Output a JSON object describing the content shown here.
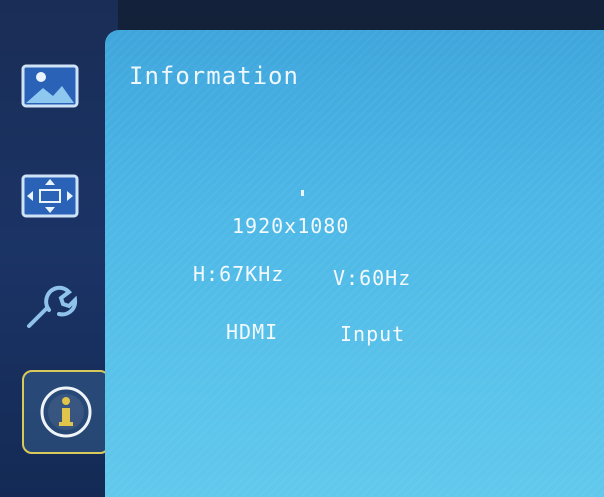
{
  "menu": {
    "items": [
      {
        "icon": "picture-icon",
        "label": ""
      },
      {
        "icon": "position-icon",
        "label": ""
      },
      {
        "icon": "setup-icon",
        "label": ""
      },
      {
        "icon": "info-icon",
        "label": "",
        "selected": true
      }
    ]
  },
  "panel": {
    "title": "Information",
    "resolution": "1920x1080",
    "h_frequency": "H:67KHz",
    "v_frequency": "V:60Hz",
    "source": "HDMI",
    "source_suffix": "Input"
  },
  "colors": {
    "panel": "#4cb6e6",
    "sidebar": "#1b3466",
    "selected_border": "#d9c85a",
    "text": "#f3f9fd"
  }
}
